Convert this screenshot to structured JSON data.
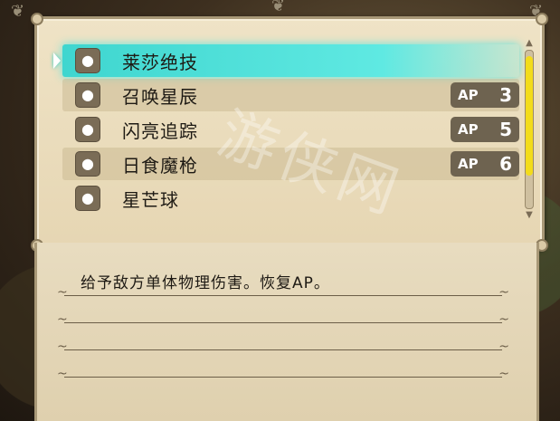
{
  "skills": [
    {
      "name": "莱莎绝技",
      "icon": "bomb-icon",
      "ap": null,
      "selected": true
    },
    {
      "name": "召唤星辰",
      "icon": "bomb-icon",
      "ap_label": "AP",
      "ap": "3",
      "selected": false
    },
    {
      "name": "闪亮追踪",
      "icon": "bomb-icon",
      "ap_label": "AP",
      "ap": "5",
      "selected": false
    },
    {
      "name": "日食魔枪",
      "icon": "bomb-icon",
      "ap_label": "AP",
      "ap": "6",
      "selected": false
    },
    {
      "name": "星芒球",
      "icon": "bomb-icon",
      "ap": null,
      "selected": false
    }
  ],
  "description": "给予敌方单体物理伤害。恢复AP。",
  "watermark": "游侠网",
  "colors": {
    "selection": "#3fd6cf",
    "scroll_thumb": "#f3dc1a",
    "ap_badge": "#6e6350"
  }
}
